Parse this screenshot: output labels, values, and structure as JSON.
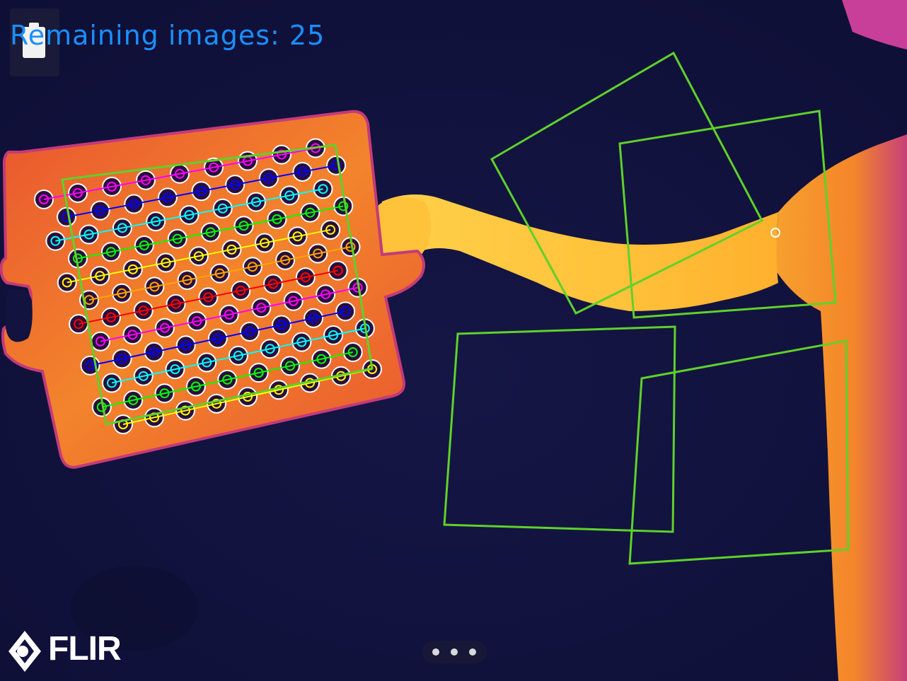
{
  "status": {
    "remaining_label": "Remaining images: 25",
    "text_color": "#1a8fff"
  },
  "brand": {
    "logo_text": "FLIR"
  },
  "colors": {
    "background": "#12133f",
    "board": "#f07a2a",
    "board_edge": "#c43a7a",
    "skin": "#ffc43a",
    "target_frame": "#5fd12a",
    "cursor": "#ffffff"
  },
  "calibration": {
    "rows": 12,
    "cols": 9,
    "row_colors": [
      "#ff00ff",
      "#0000ff",
      "#00ffff",
      "#00ff00",
      "#ffff00",
      "#ffa500",
      "#ff0000",
      "#ff00ff",
      "#0000ff",
      "#00ffff",
      "#00ff00",
      "#ffff00"
    ]
  },
  "controls": {
    "page_indicator_dots": 3,
    "battery_icon": "battery-icon",
    "diamond_icon": "flir-diamond-icon"
  }
}
